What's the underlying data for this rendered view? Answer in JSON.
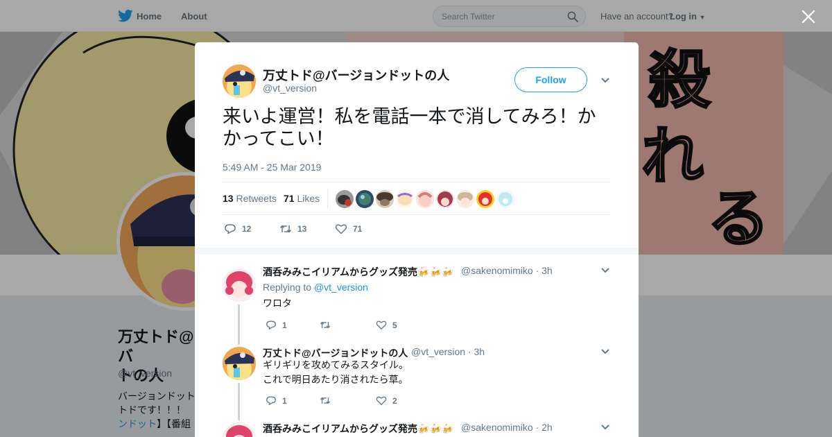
{
  "topbar": {
    "home_label": "Home",
    "about_label": "About",
    "search_placeholder": "Search Twitter",
    "have_account": "Have an account?",
    "login_label": "Log in"
  },
  "profile": {
    "name_line1": "万丈トド@バ",
    "name_line2": "トの人",
    "handle": "@vt_version",
    "bio_line1": "バージョンドット",
    "bio_line2": "トドです！！！",
    "bio_link": "ンドット",
    "bio_rest": "】【番組"
  },
  "tweet": {
    "author_name": "万丈トド@バージョンドットの人",
    "author_handle": "@vt_version",
    "follow_label": "Follow",
    "text": "来いよ運営！私を電話一本で消してみろ！かかってこい！",
    "timestamp": "5:49 AM - 25 Mar 2019",
    "retweets_count": "13",
    "retweets_label": "Retweets",
    "likes_count": "71",
    "likes_label": "Likes",
    "actions": {
      "replies": "12",
      "retweets": "13",
      "likes": "71"
    }
  },
  "replies": [
    {
      "name": "酒呑みみこイリアムからグッズ発売",
      "handle": "@sakenomimiko",
      "time": "3h",
      "replying_prefix": "Replying to",
      "replying_to": "@vt_version",
      "text_lines": [
        "ワロタ"
      ],
      "counts": {
        "replies": "1",
        "retweets": "",
        "likes": "5"
      }
    },
    {
      "name": "万丈トド@バージョンドットの人",
      "handle": "@vt_version",
      "time": "3h",
      "text_lines": [
        "ギリギリを攻めてみるスタイル。",
        "これで明日あたり消されたら草。"
      ],
      "counts": {
        "replies": "1",
        "retweets": "",
        "likes": "2"
      }
    },
    {
      "name": "酒呑みみこイリアムからグッズ発売",
      "handle": "@sakenomimiko",
      "time": "2h"
    }
  ],
  "separator": "·",
  "colors": {
    "accent": "#1da1f2",
    "link": "#1b95e0",
    "text": "#14171a",
    "muted": "#657786"
  }
}
